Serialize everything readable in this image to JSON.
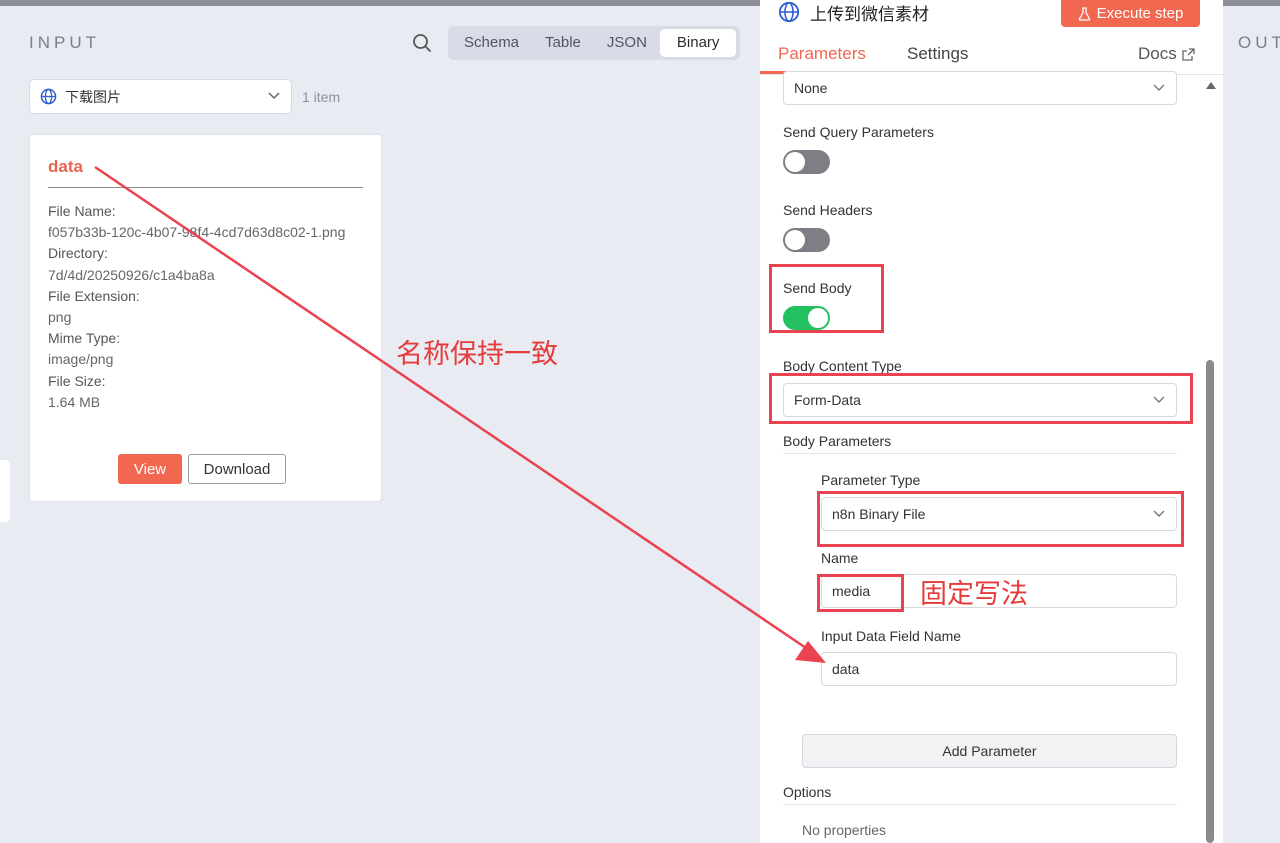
{
  "input_panel": {
    "title": "INPUT",
    "tabs": [
      "Schema",
      "Table",
      "JSON",
      "Binary"
    ],
    "active_tab": "Binary",
    "node_select": "下载图片",
    "item_count": "1 item",
    "binary_card": {
      "key": "data",
      "fields": [
        {
          "label": "File Name:",
          "value": "f057b33b-120c-4b07-98f4-4cd7d63d8c02-1.png"
        },
        {
          "label": "Directory:",
          "value": "7d/4d/20250926/c1a4ba8a"
        },
        {
          "label": "File Extension:",
          "value": "png"
        },
        {
          "label": "Mime Type:",
          "value": "image/png"
        },
        {
          "label": "File Size:",
          "value": "1.64 MB"
        }
      ],
      "view_label": "View",
      "download_label": "Download"
    }
  },
  "node_panel": {
    "title": "上传到微信素材",
    "execute_label": "Execute step",
    "tabs": {
      "parameters": "Parameters",
      "settings": "Settings",
      "docs": "Docs"
    },
    "auth_select": "None",
    "send_query": {
      "label": "Send Query Parameters",
      "on": false
    },
    "send_headers": {
      "label": "Send Headers",
      "on": false
    },
    "send_body": {
      "label": "Send Body",
      "on": true
    },
    "body_content_type": {
      "label": "Body Content Type",
      "value": "Form-Data"
    },
    "body_parameters": {
      "label": "Body Parameters",
      "parameter_type": {
        "label": "Parameter Type",
        "value": "n8n Binary File"
      },
      "name": {
        "label": "Name",
        "value": "media"
      },
      "input_field": {
        "label": "Input Data Field Name",
        "value": "data"
      }
    },
    "add_parameter": "Add Parameter",
    "options_label": "Options",
    "no_properties": "No properties"
  },
  "output_panel": {
    "title": "OUT"
  },
  "annotations": {
    "arrow_note": "名称保持一致",
    "fixed_note": "固定写法",
    "color": "#e53b3b"
  }
}
